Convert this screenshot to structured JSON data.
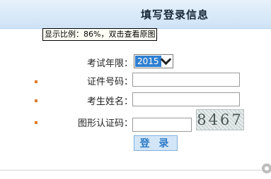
{
  "header": {
    "title": "填写登录信息"
  },
  "scale_note": "显示比例：86%，双击查看原图",
  "form": {
    "year_label": "考试年限：",
    "year_value": "2015",
    "id_label": "证件号码：",
    "name_label": "考生姓名：",
    "captcha_label": "图形认证码：",
    "captcha_text": "8467",
    "login_label": "登 录"
  },
  "colors": {
    "header_bg": "#d6e8f8",
    "bullet": "#e07a2a",
    "button_text": "#2e7cc7",
    "select_highlight": "#2f7fd1"
  }
}
